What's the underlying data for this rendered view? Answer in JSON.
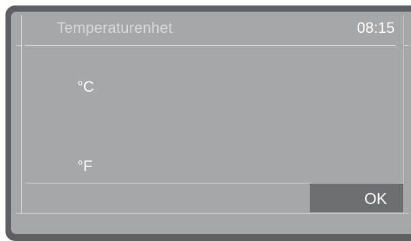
{
  "screen": {
    "title": "Temperaturenhet",
    "clock": "08:15"
  },
  "options": [
    {
      "label": "°C"
    },
    {
      "label": "°F"
    }
  ],
  "footer": {
    "ok_label": "OK"
  },
  "colors": {
    "bezel": "#5f5f61",
    "screen": "#a6a7a9",
    "ok_button": "#6d6e70",
    "text": "#ffffff",
    "title_text": "#d8d9db"
  }
}
